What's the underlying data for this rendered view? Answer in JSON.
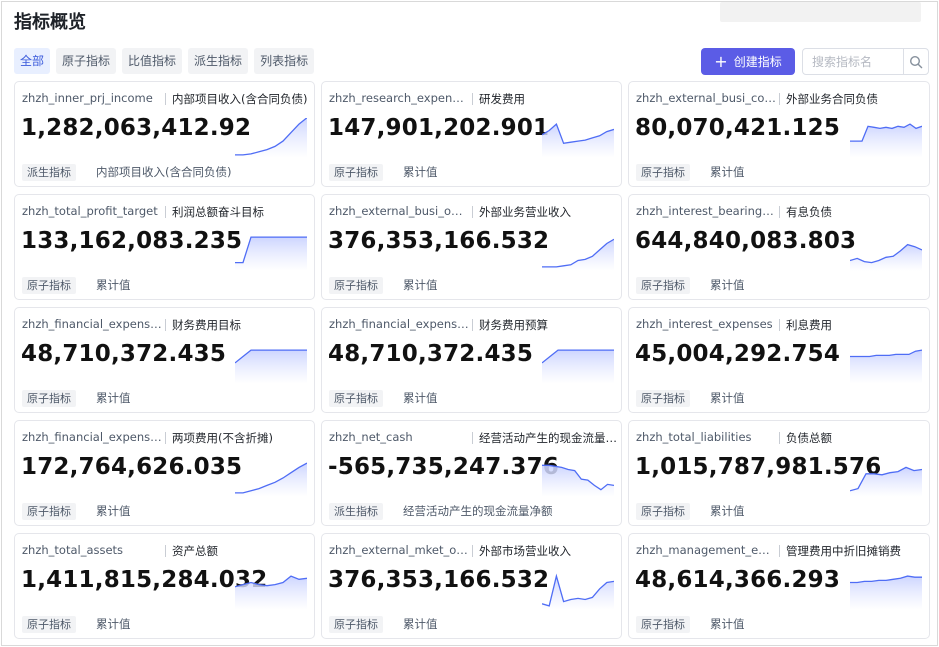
{
  "page": {
    "title": "指标概览"
  },
  "filters": [
    {
      "label": "全部",
      "active": true
    },
    {
      "label": "原子指标",
      "active": false
    },
    {
      "label": "比值指标",
      "active": false
    },
    {
      "label": "派生指标",
      "active": false
    },
    {
      "label": "列表指标",
      "active": false
    }
  ],
  "toolbar": {
    "create_label": "创建指标",
    "search_placeholder": "搜索指标名"
  },
  "colors": {
    "accent": "#5b5ce6",
    "line": "#4f6df5",
    "fill_top": "#c7d0ff",
    "fill_bottom": "#ffffff"
  },
  "cards": [
    {
      "code": "zhzh_inner_prj_income",
      "name": "内部项目收入(含合同负债)",
      "value": "1,282,063,412.92",
      "tag": "派生指标",
      "desc": "内部项目收入(含合同负债)",
      "trend": [
        1,
        1,
        2,
        4,
        6,
        9,
        14,
        22,
        30,
        36
      ]
    },
    {
      "code": "zhzh_research_expenses",
      "name": "研发费用",
      "value": "147,901,202.901",
      "tag": "原子指标",
      "desc": "累计值",
      "trend": [
        20,
        24,
        30,
        12,
        13,
        14,
        15,
        17,
        19,
        23,
        25
      ]
    },
    {
      "code": "zhzh_external_busi_contract",
      "name": "外部业务合同负债",
      "value": "80,070,421.125",
      "tag": "原子指标",
      "desc": "累计值",
      "trend": [
        14,
        14,
        14,
        28,
        27,
        26,
        27,
        26,
        28,
        27,
        30,
        26,
        28
      ]
    },
    {
      "code": "zhzh_total_profit_target",
      "name": "利润总额奋斗目标",
      "value": "133,162,083.235",
      "tag": "原子指标",
      "desc": "累计值",
      "trend": [
        6,
        6,
        30,
        30,
        30,
        30,
        30,
        30,
        30,
        30
      ]
    },
    {
      "code": "zhzh_external_busi_operating",
      "name": "外部业务营业收入",
      "value": "376,353,166.532",
      "tag": "原子指标",
      "desc": "累计值",
      "trend": [
        2,
        2,
        2,
        3,
        4,
        8,
        9,
        12,
        18,
        24,
        28
      ]
    },
    {
      "code": "zhzh_interest_bearing_liabilities",
      "name": "有息负债",
      "value": "644,840,083.803",
      "tag": "原子指标",
      "desc": "累计值",
      "trend": [
        8,
        10,
        7,
        6,
        8,
        11,
        12,
        17,
        23,
        21,
        18
      ]
    },
    {
      "code": "zhzh_financial_expenses_target",
      "name": "财务费用目标",
      "value": "48,710,372.435",
      "tag": "原子指标",
      "desc": "累计值",
      "trend": [
        18,
        24,
        30,
        30,
        30,
        30,
        30,
        30,
        30,
        30
      ]
    },
    {
      "code": "zhzh_financial_expenses_budget",
      "name": "财务费用预算",
      "value": "48,710,372.435",
      "tag": "原子指标",
      "desc": "累计值",
      "trend": [
        18,
        24,
        30,
        30,
        30,
        30,
        30,
        30,
        30,
        30
      ]
    },
    {
      "code": "zhzh_interest_expenses",
      "name": "利息费用",
      "value": "45,004,292.754",
      "tag": "原子指标",
      "desc": "累计值",
      "trend": [
        24,
        24,
        24,
        24,
        25,
        25,
        25,
        26,
        26,
        26,
        29,
        30
      ]
    },
    {
      "code": "zhzh_financial_expenses_two",
      "name": "两项费用(不含折摊)",
      "value": "172,764,626.035",
      "tag": "原子指标",
      "desc": "累计值",
      "trend": [
        2,
        2,
        4,
        6,
        9,
        12,
        16,
        21,
        26,
        30
      ]
    },
    {
      "code": "zhzh_net_cash",
      "name": "经营活动产生的现金流量净额",
      "value": "-565,735,247.376",
      "tag": "派生指标",
      "desc": "经营活动产生的现金流量净额",
      "trend": [
        28,
        28,
        27,
        26,
        24,
        23,
        15,
        14,
        9,
        5,
        10,
        9
      ]
    },
    {
      "code": "zhzh_total_liabilities",
      "name": "负债总额",
      "value": "1,015,787,981.576",
      "tag": "原子指标",
      "desc": "累计值",
      "trend": [
        4,
        6,
        20,
        20,
        19,
        21,
        22,
        26,
        23,
        24
      ]
    },
    {
      "code": "zhzh_total_assets",
      "name": "资产总额",
      "value": "1,411,815,284.032",
      "tag": "原子指标",
      "desc": "累计值",
      "trend": [
        20,
        22,
        24,
        22,
        21,
        22,
        24,
        30,
        27,
        28
      ]
    },
    {
      "code": "zhzh_external_mket_operating",
      "name": "外部市场营业收入",
      "value": "376,353,166.532",
      "tag": "原子指标",
      "desc": "累计值",
      "trend": [
        4,
        2,
        30,
        6,
        8,
        9,
        8,
        10,
        18,
        24,
        25
      ]
    },
    {
      "code": "zhzh_management_expenses",
      "name": "管理费用中折旧摊销费",
      "value": "48,614,366.293",
      "tag": "原子指标",
      "desc": "累计值",
      "trend": [
        24,
        24,
        25,
        25,
        26,
        26,
        27,
        28,
        30,
        29,
        29
      ]
    }
  ]
}
